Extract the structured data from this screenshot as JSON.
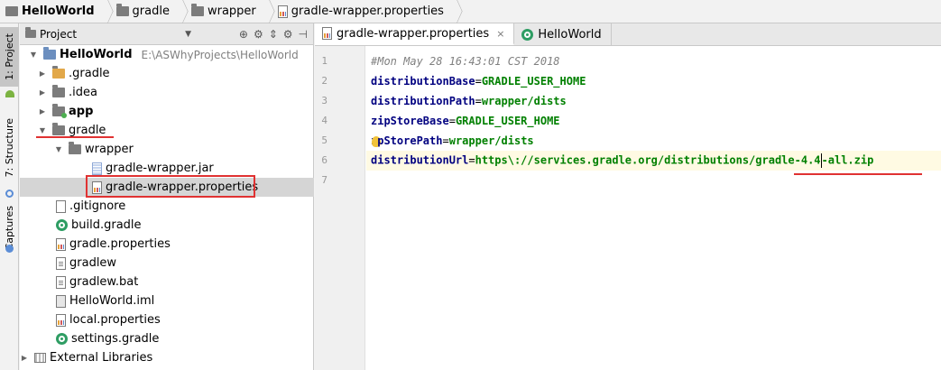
{
  "breadcrumb": [
    {
      "label": "HelloWorld",
      "icon": "module-icon"
    },
    {
      "label": "gradle",
      "icon": "folder-icon"
    },
    {
      "label": "wrapper",
      "icon": "folder-icon"
    },
    {
      "label": "gradle-wrapper.properties",
      "icon": "properties-file-icon"
    }
  ],
  "stripe": {
    "project": "1: Project",
    "structure": "7: Structure",
    "captures": "Captures"
  },
  "panel": {
    "title": "Project",
    "tree": [
      {
        "label": "HelloWorld",
        "path": "E:\\ASWhyProjects\\HelloWorld",
        "bold": true,
        "expanded": true
      },
      {
        "label": ".gradle"
      },
      {
        "label": ".idea"
      },
      {
        "label": "app",
        "bold": true
      },
      {
        "label": "gradle",
        "expanded": true
      },
      {
        "label": "wrapper",
        "expanded": true
      },
      {
        "label": "gradle-wrapper.jar"
      },
      {
        "label": "gradle-wrapper.properties",
        "selected": true
      },
      {
        "label": ".gitignore"
      },
      {
        "label": "build.gradle"
      },
      {
        "label": "gradle.properties"
      },
      {
        "label": "gradlew"
      },
      {
        "label": "gradlew.bat"
      },
      {
        "label": "HelloWorld.iml"
      },
      {
        "label": "local.properties"
      },
      {
        "label": "settings.gradle"
      },
      {
        "label": "External Libraries"
      }
    ]
  },
  "editor": {
    "tabs": [
      {
        "label": "gradle-wrapper.properties",
        "active": true,
        "close": "×"
      },
      {
        "label": "HelloWorld",
        "active": false
      }
    ],
    "lines": [
      {
        "num": "1",
        "comment": "#Mon May 28 16:43:01 CST 2018"
      },
      {
        "num": "2",
        "key": "distributionBase",
        "eq": "=",
        "value": "GRADLE_USER_HOME"
      },
      {
        "num": "3",
        "key": "distributionPath",
        "eq": "=",
        "value": "wrapper/dists"
      },
      {
        "num": "4",
        "key": "zipStoreBase",
        "eq": "=",
        "value": "GRADLE_USER_HOME"
      },
      {
        "num": "5",
        "key_a": "z",
        "key_b": "pStorePath",
        "eq": "=",
        "value": "wrapper/dists"
      },
      {
        "num": "6",
        "key": "distributionUrl",
        "eq": "=",
        "value_a": "https\\://services.gradle.org/distributions/gradle-4.4",
        "value_b": "-all.zip"
      },
      {
        "num": "7"
      }
    ]
  },
  "colors": {
    "annotation": "#e03232",
    "key": "#000080",
    "value": "#008000",
    "comment": "#808080"
  }
}
